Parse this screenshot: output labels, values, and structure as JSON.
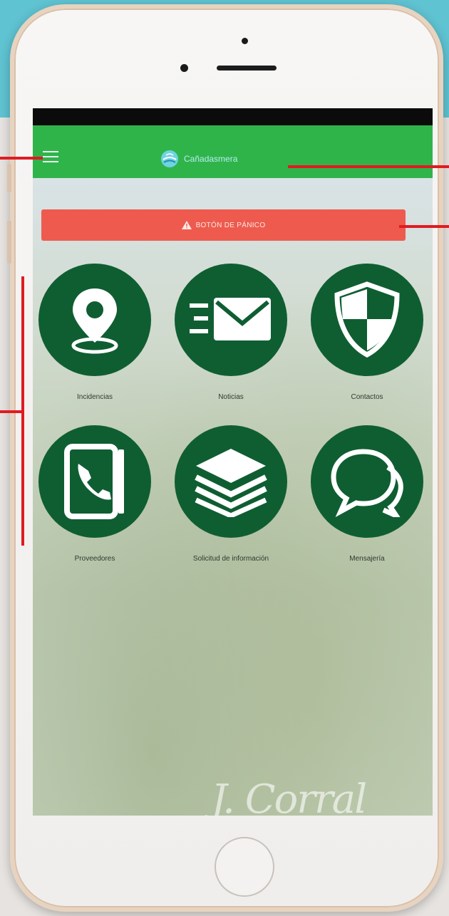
{
  "app": {
    "brand_name": "Cañadasmera",
    "colors": {
      "appbar": "#2fb44a",
      "panic": "#ee5b4e",
      "tile": "#0f5e32"
    }
  },
  "appbar": {
    "menu_icon": "hamburger-menu-icon"
  },
  "panic_button": {
    "label": "BOTÓN DE PÁNICO",
    "icon": "warning-triangle-icon"
  },
  "tiles": [
    {
      "label": "Incidencias",
      "icon": "location-pin-icon"
    },
    {
      "label": "Noticias",
      "icon": "envelope-icon"
    },
    {
      "label": "Contactos",
      "icon": "shield-icon"
    },
    {
      "label": "Proveedores",
      "icon": "phone-book-icon"
    },
    {
      "label": "Solicitud de información",
      "icon": "layers-icon"
    },
    {
      "label": "Mensajería",
      "icon": "chat-bubbles-icon"
    }
  ],
  "signature": {
    "text": "J. Corral",
    "subtext": ""
  }
}
